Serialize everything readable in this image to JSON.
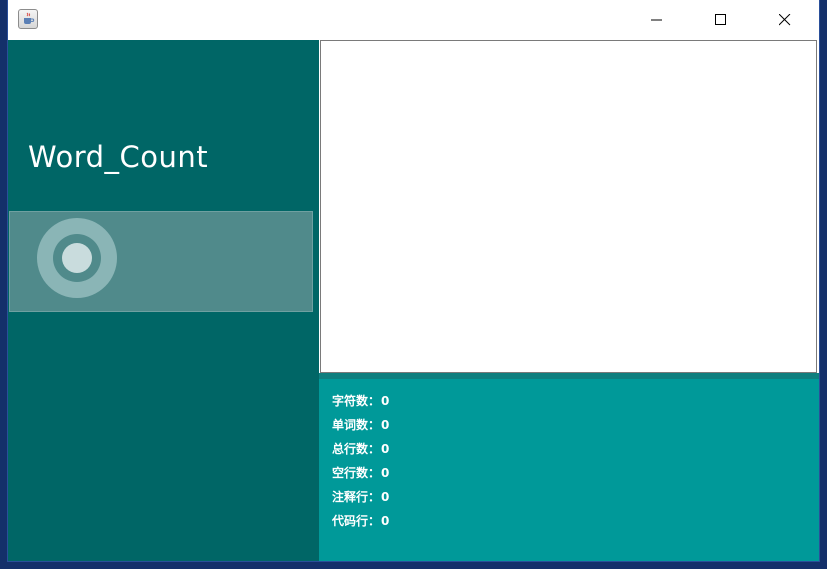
{
  "window": {
    "icon": "java-cup-icon",
    "controls": {
      "minimize": "minimize-icon",
      "maximize": "maximize-icon",
      "close": "close-icon"
    }
  },
  "app": {
    "title": "Word_Count"
  },
  "upload_button": {
    "icon": "circle-ring-icon"
  },
  "text_area": {
    "value": ""
  },
  "stats": [
    {
      "label": "字符数：",
      "value": "0"
    },
    {
      "label": "单词数：",
      "value": "0"
    },
    {
      "label": "总行数：",
      "value": "0"
    },
    {
      "label": "空行数：",
      "value": "0"
    },
    {
      "label": "注释行：",
      "value": "0"
    },
    {
      "label": "代码行：",
      "value": "0"
    }
  ],
  "colors": {
    "left_panel": "#006666",
    "stats_panel": "#009999",
    "button_panel": "#508a8b",
    "desktop": "#14306a"
  }
}
